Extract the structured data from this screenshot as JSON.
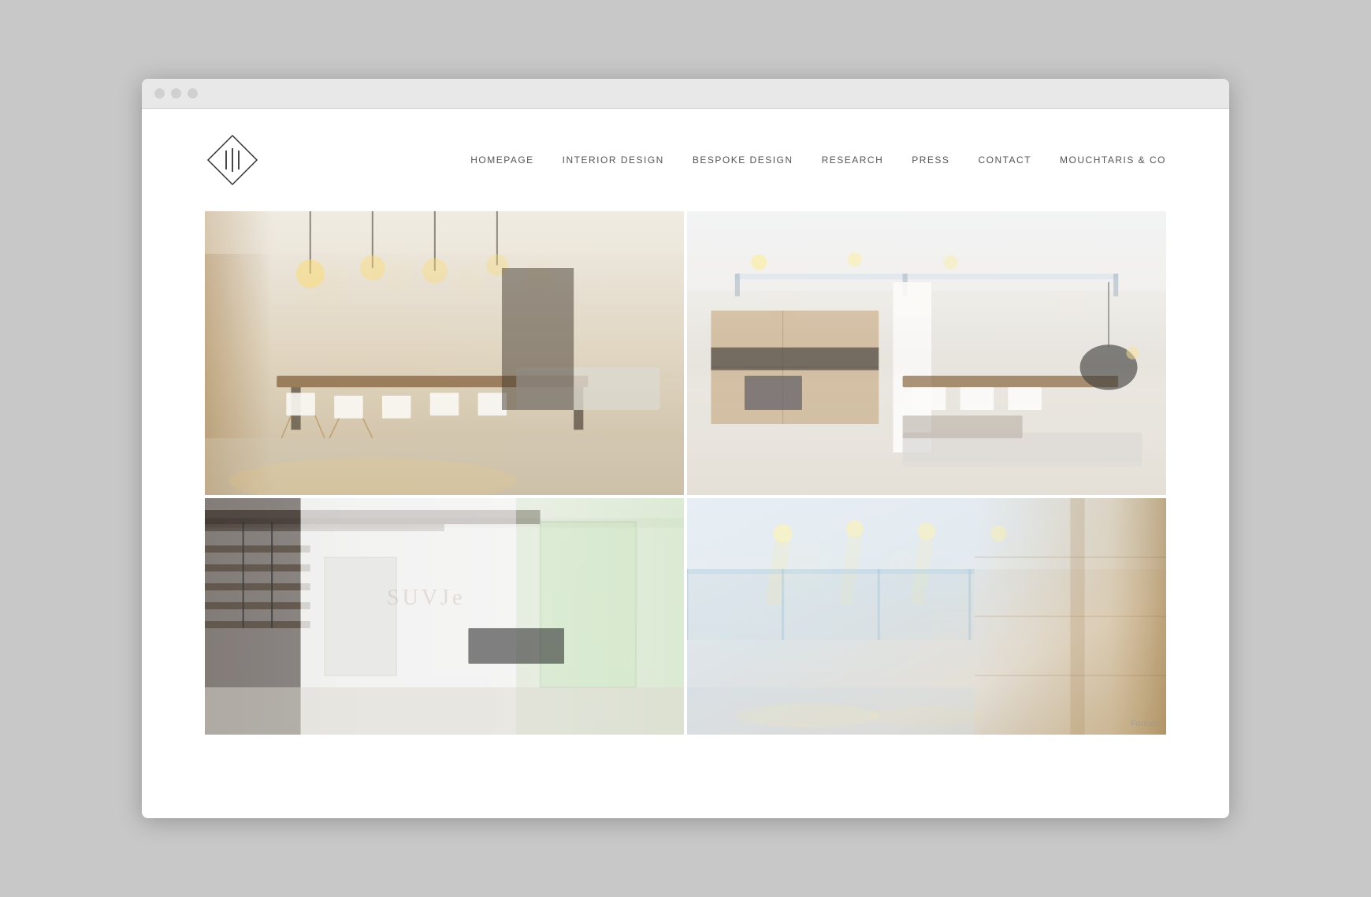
{
  "browser": {
    "dots": [
      "dot1",
      "dot2",
      "dot3"
    ]
  },
  "header": {
    "logo_text": "111",
    "logo_aria": "111 Studio Logo"
  },
  "nav": {
    "items": [
      {
        "label": "HOMEPAGE",
        "id": "nav-homepage"
      },
      {
        "label": "INTERIOR DESIGN",
        "id": "nav-interior-design"
      },
      {
        "label": "BESPOKE DESIGN",
        "id": "nav-bespoke-design"
      },
      {
        "label": "RESEARCH",
        "id": "nav-research"
      },
      {
        "label": "PRESS",
        "id": "nav-press"
      },
      {
        "label": "CONTACT",
        "id": "nav-contact"
      },
      {
        "label": "MOUCHTARIS & CO",
        "id": "nav-mouchtaris"
      }
    ]
  },
  "gallery": {
    "images": [
      {
        "id": "img-top-left",
        "alt": "Modern interior with dining area and pendant lights",
        "position": "top-left"
      },
      {
        "id": "img-top-right",
        "alt": "Open plan kitchen and living area with mezzanine",
        "position": "top-right"
      },
      {
        "id": "img-bottom-left",
        "alt": "Staircase and living room interior",
        "position": "bottom-left"
      },
      {
        "id": "img-bottom-right",
        "alt": "Glass railing and wooden wall detail with recessed lighting",
        "position": "bottom-right"
      }
    ],
    "watermark": "Format"
  }
}
